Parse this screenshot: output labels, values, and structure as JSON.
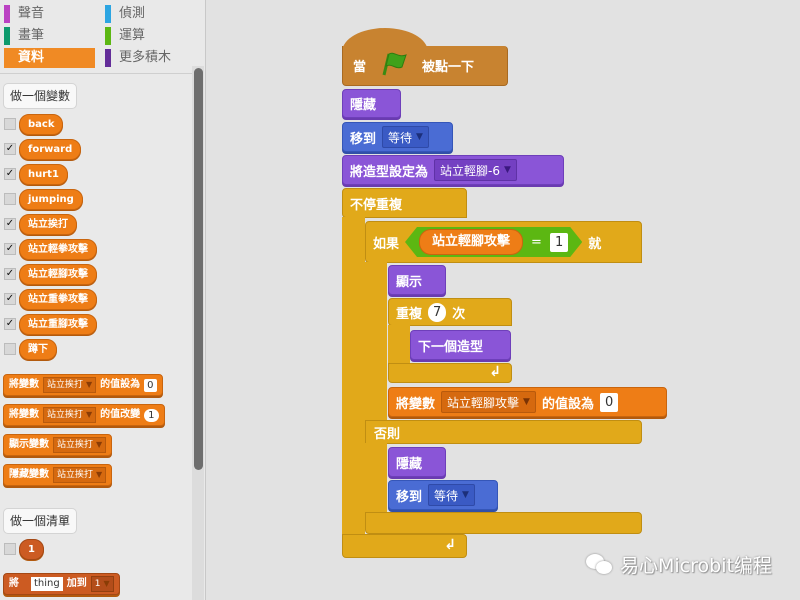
{
  "palette": {
    "categories": [
      {
        "label": "聲音",
        "color": "#bb42c3",
        "col": 0,
        "active": false
      },
      {
        "label": "偵測",
        "color": "#2ca5e2",
        "col": 1,
        "active": false
      },
      {
        "label": "畫筆",
        "color": "#0e9a6c",
        "col": 0,
        "active": false
      },
      {
        "label": "運算",
        "color": "#5cb712",
        "col": 1,
        "active": false
      },
      {
        "label": "資料",
        "color": "#ee7d16",
        "col": 0,
        "active": true
      },
      {
        "label": "更多積木",
        "color": "#632d99",
        "col": 1,
        "active": false
      }
    ],
    "make_variable_label": "做一個變數",
    "variables": [
      {
        "name": "back",
        "checked": false
      },
      {
        "name": "forward",
        "checked": true
      },
      {
        "name": "hurt1",
        "checked": true
      },
      {
        "name": "jumping",
        "checked": false
      },
      {
        "name": "站立挨打",
        "checked": true
      },
      {
        "name": "站立輕拳攻擊",
        "checked": true
      },
      {
        "name": "站立輕腳攻擊",
        "checked": true
      },
      {
        "name": "站立重拳攻擊",
        "checked": true
      },
      {
        "name": "站立重腳攻擊",
        "checked": true
      },
      {
        "name": "蹲下",
        "checked": false
      }
    ],
    "set_block": {
      "prefix": "將變數",
      "var": "站立挨打",
      "suffix": "的值設為",
      "value": "0"
    },
    "change_block": {
      "prefix": "將變數",
      "var": "站立挨打",
      "suffix": "的值改變",
      "value": "1"
    },
    "show_var_block": {
      "prefix": "顯示變數",
      "var": "站立挨打"
    },
    "hide_var_block": {
      "prefix": "隱藏變數",
      "var": "站立挨打"
    },
    "make_list_label": "做一個清單",
    "list": {
      "name": "1",
      "checked": false
    },
    "add_block": {
      "prefix": "將",
      "item": "thing",
      "middle": "加到",
      "list": "1"
    }
  },
  "script": {
    "hat": {
      "before": "當",
      "after": "被點一下",
      "icon": "green-flag-icon"
    },
    "hide1": "隱藏",
    "goto1": {
      "label": "移到",
      "target": "等待"
    },
    "switch_costume": {
      "label": "將造型設定為",
      "costume": "站立輕腳-6"
    },
    "forever": "不停重複",
    "if": {
      "label": "如果",
      "var": "站立輕腳攻擊",
      "op": "=",
      "value": "1",
      "then": "就"
    },
    "show": "顯示",
    "repeat": {
      "label": "重複",
      "count": "7",
      "suffix": "次"
    },
    "next_costume": "下一個造型",
    "set_var": {
      "label": "將變數",
      "var": "站立輕腳攻擊",
      "suffix": "的值設為",
      "value": "0"
    },
    "else": "否則",
    "hide2": "隱藏",
    "goto2": {
      "label": "移到",
      "target": "等待"
    }
  },
  "watermark": "易心Microbit编程"
}
